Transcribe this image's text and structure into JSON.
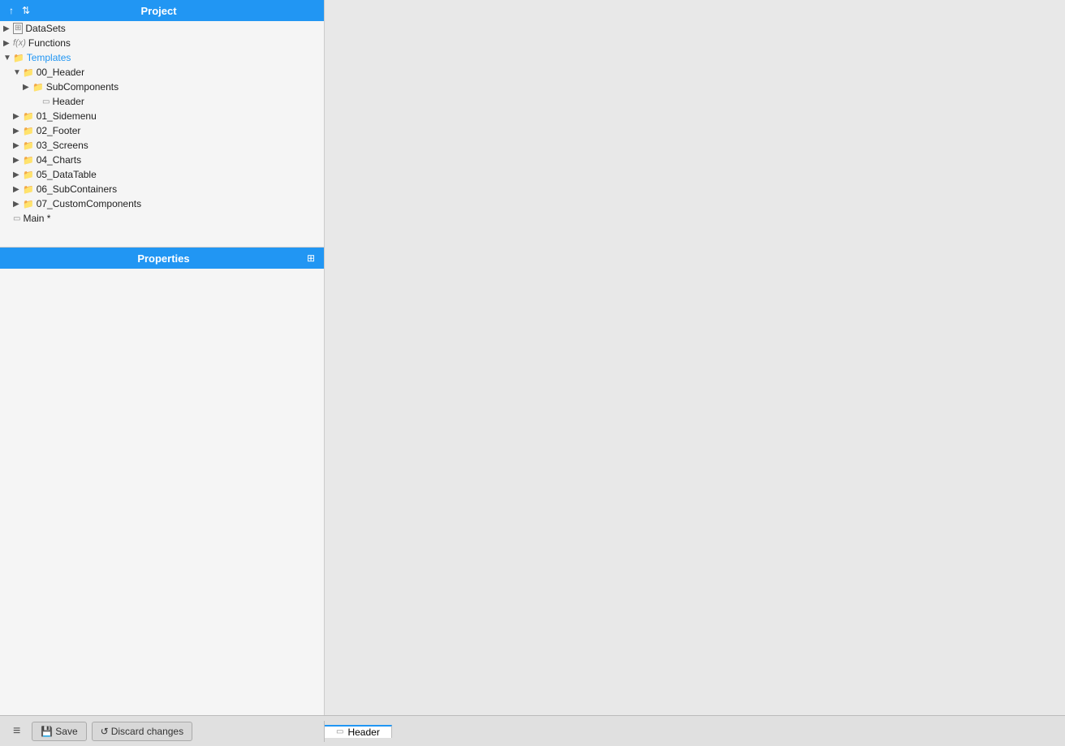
{
  "header": {
    "title": "Project",
    "icons": [
      "↑",
      "↕"
    ]
  },
  "tree": {
    "items": [
      {
        "id": "datasets",
        "label": "DataSets",
        "indent": 0,
        "type": "dataset",
        "expanded": false,
        "chevron": "▶"
      },
      {
        "id": "functions",
        "label": "Functions",
        "indent": 0,
        "type": "func",
        "expanded": false,
        "chevron": "▶"
      },
      {
        "id": "templates",
        "label": "Templates",
        "indent": 0,
        "type": "folder",
        "expanded": true,
        "chevron": "▼",
        "selected": false,
        "blue": true
      },
      {
        "id": "00_header_folder",
        "label": "00_Header",
        "indent": 1,
        "type": "folder",
        "expanded": true,
        "chevron": "▼"
      },
      {
        "id": "subcomponents",
        "label": "SubComponents",
        "indent": 2,
        "type": "folder",
        "expanded": false,
        "chevron": "▶"
      },
      {
        "id": "header_template",
        "label": "Header",
        "indent": 2,
        "type": "template",
        "expanded": false,
        "chevron": ""
      },
      {
        "id": "01_sidemenu",
        "label": "01_Sidemenu",
        "indent": 1,
        "type": "folder",
        "expanded": false,
        "chevron": "▶"
      },
      {
        "id": "02_footer",
        "label": "02_Footer",
        "indent": 1,
        "type": "folder",
        "expanded": false,
        "chevron": "▶"
      },
      {
        "id": "03_screens",
        "label": "03_Screens",
        "indent": 1,
        "type": "folder",
        "expanded": false,
        "chevron": "▶"
      },
      {
        "id": "04_charts",
        "label": "04_Charts",
        "indent": 1,
        "type": "folder",
        "expanded": false,
        "chevron": "▶"
      },
      {
        "id": "05_datatable",
        "label": "05_DataTable",
        "indent": 1,
        "type": "folder",
        "expanded": false,
        "chevron": "▶"
      },
      {
        "id": "06_subcontainers",
        "label": "06_SubContainers",
        "indent": 1,
        "type": "folder",
        "expanded": false,
        "chevron": "▶"
      },
      {
        "id": "07_customcomponents",
        "label": "07_CustomComponents",
        "indent": 1,
        "type": "folder",
        "expanded": false,
        "chevron": "▶"
      },
      {
        "id": "main",
        "label": "Main *",
        "indent": 0,
        "type": "template",
        "expanded": false,
        "chevron": ""
      }
    ]
  },
  "properties": {
    "title": "Properties",
    "icon": "⊞"
  },
  "bottom_bar": {
    "hamburger": "≡",
    "save_label": "Save",
    "discard_label": "Discard changes",
    "save_icon": "💾",
    "discard_icon": "↺"
  },
  "tabs": [
    {
      "id": "header_tab",
      "label": "Header",
      "icon": "▭",
      "active": true
    }
  ]
}
